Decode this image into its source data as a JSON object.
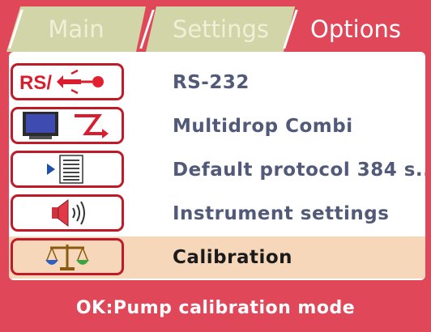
{
  "tabs": [
    {
      "label": "Main",
      "active": false
    },
    {
      "label": "Settings",
      "active": false
    },
    {
      "label": "Options",
      "active": true
    }
  ],
  "list": [
    {
      "icon_text": "RS/",
      "icon": "rs232-cable-icon",
      "label": "RS-232",
      "selected": false
    },
    {
      "icon": "monitor-link-icon",
      "label": "Multidrop Combi",
      "selected": false
    },
    {
      "icon": "protocol-document-icon",
      "label": "Default protocol 384 s...",
      "selected": false
    },
    {
      "icon": "speaker-icon",
      "label": "Instrument settings",
      "selected": false
    },
    {
      "icon": "balance-scale-icon",
      "label": "Calibration",
      "selected": true
    }
  ],
  "status": {
    "text": "OK:Pump calibration mode"
  },
  "colors": {
    "accent_red": "#e0485a",
    "icon_border": "#c01a28",
    "selected_row": "#f7d7ba",
    "inactive_tab": "#d2d5a8",
    "item_text": "#525a7a"
  }
}
